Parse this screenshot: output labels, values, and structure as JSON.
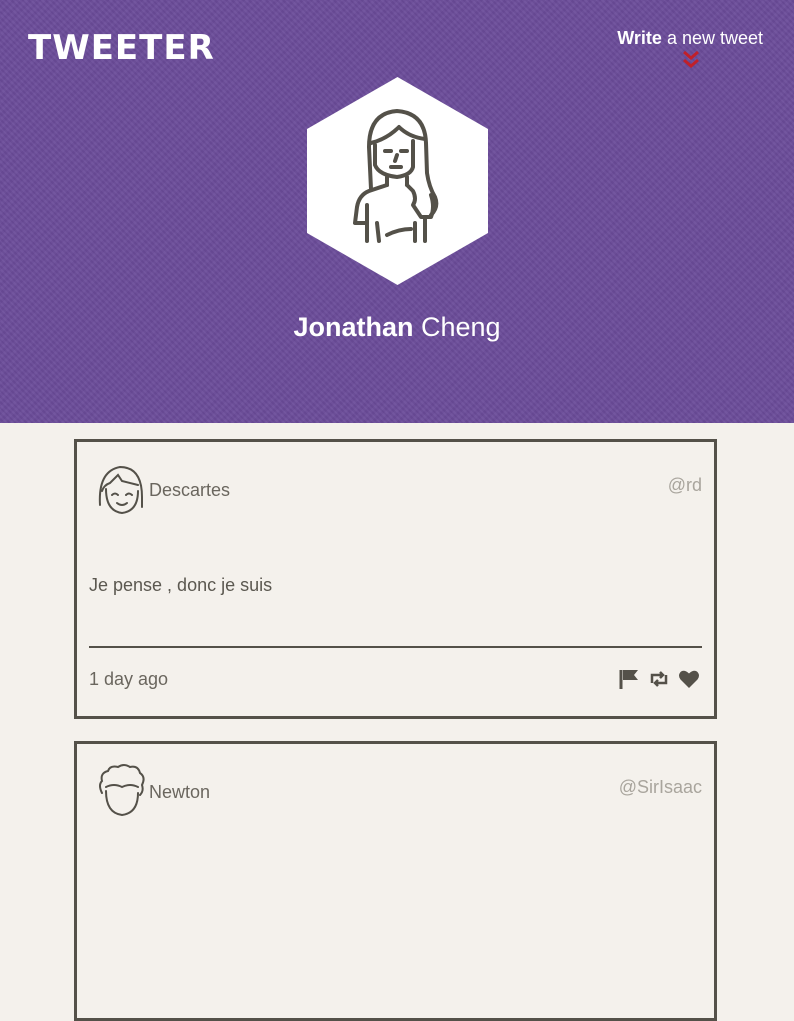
{
  "app": {
    "logo": "TWEETER"
  },
  "compose": {
    "bold": "Write",
    "rest": " a new tweet"
  },
  "profile": {
    "first_name": "Jonathan",
    "last_name": " Cheng",
    "avatar_icon": "woman-avatar-icon"
  },
  "colors": {
    "header": "#6b4c9a",
    "background": "#f4f1ec",
    "border": "#545149",
    "accent": "#c0202a"
  },
  "tweets": [
    {
      "name": "Descartes",
      "handle": "@rd",
      "text": "Je pense , donc je suis",
      "time": "1 day ago",
      "avatar_icon": "smiling-face-avatar-icon"
    },
    {
      "name": "Newton",
      "handle": "@SirIsaac",
      "text": "",
      "time": "",
      "avatar_icon": "curly-hair-avatar-icon"
    }
  ]
}
